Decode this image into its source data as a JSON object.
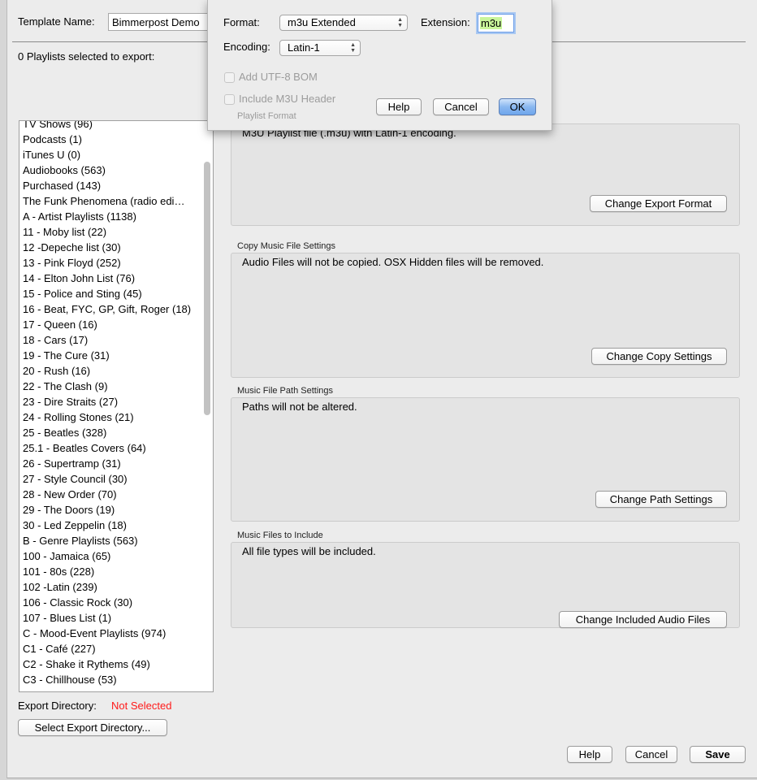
{
  "template": {
    "label": "Template Name:",
    "value": "Bimmerpost Demo"
  },
  "selected_count_label": "0 Playlists selected to export:",
  "playlists": [
    "TV Shows (96)",
    "Podcasts (1)",
    "iTunes U (0)",
    "Audiobooks (563)",
    "Purchased (143)",
    "The Funk Phenomena (radio edi…",
    "A - Artist Playlists (1138)",
    "11 - Moby list (22)",
    "12 -Depeche list (30)",
    "13 - Pink Floyd (252)",
    "14 - Elton John List (76)",
    "15 - Police and Sting (45)",
    "16 - Beat, FYC, GP, Gift, Roger (18)",
    "17 - Queen (16)",
    "18 - Cars (17)",
    "19 - The Cure (31)",
    "20 - Rush (16)",
    "22 - The Clash (9)",
    "23 - Dire Straits (27)",
    "24 - Rolling Stones (21)",
    "25 - Beatles (328)",
    "25.1 - Beatles Covers (64)",
    "26 - Supertramp (31)",
    "27 - Style Council (30)",
    "28 - New Order (70)",
    "29 - The Doors (19)",
    "30 - Led Zeppelin (18)",
    "B - Genre Playlists (563)",
    "100 - Jamaica (65)",
    "101 - 80s (228)",
    "102 -Latin (239)",
    "106 - Classic Rock (30)",
    "107 - Blues List (1)",
    "C - Mood-Event Playlists (974)",
    "C1 - Café (227)",
    "C2 - Shake it Rythems (49)",
    "C3 - Chillhouse (53)"
  ],
  "sections": [
    {
      "label": "Playlist Format",
      "text": "M3U Playlist file (.m3u) with Latin-1 encoding.",
      "button": "Change Export Format"
    },
    {
      "label": "Copy Music File Settings",
      "text": "Audio Files will not be copied. OSX Hidden files will be removed.",
      "button": "Change Copy Settings"
    },
    {
      "label": "Music File Path Settings",
      "text": "Paths will not be altered.",
      "button": "Change Path Settings"
    },
    {
      "label": "Music Files to Include",
      "text": "All file types will be included.",
      "button": "Change Included Audio Files"
    }
  ],
  "export_dir": {
    "label": "Export Directory:",
    "value": "Not Selected",
    "value_color": "#ff1a1a",
    "button": "Select Export Directory..."
  },
  "footer": {
    "help": "Help",
    "cancel": "Cancel",
    "save": "Save"
  },
  "dialog": {
    "format_label": "Format:",
    "format_value": "m3u Extended",
    "extension_label": "Extension:",
    "extension_value": "m3u",
    "encoding_label": "Encoding:",
    "encoding_value": "Latin-1",
    "bom_label": "Add UTF-8 BOM",
    "header_label": "Include M3U Header",
    "help": "Help",
    "cancel": "Cancel",
    "ok": "OK"
  }
}
